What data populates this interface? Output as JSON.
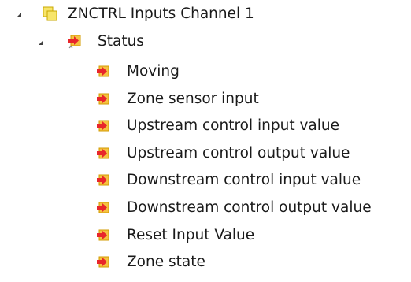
{
  "tree": {
    "root": {
      "label": "ZNCTRL Inputs Channel 1",
      "icon": "folder-group-icon",
      "expanded": true,
      "children": [
        {
          "label": "Status",
          "icon": "input-variable-icon",
          "expanded": true,
          "children": [
            {
              "label": "Moving",
              "icon": "input-variable-icon"
            },
            {
              "label": "Zone sensor input",
              "icon": "input-variable-icon"
            },
            {
              "label": "Upstream control input value",
              "icon": "input-variable-icon"
            },
            {
              "label": "Upstream control output value",
              "icon": "input-variable-icon"
            },
            {
              "label": "Downstream control input value",
              "icon": "input-variable-icon"
            },
            {
              "label": "Downstream control output value",
              "icon": "input-variable-icon"
            },
            {
              "label": "Reset Input Value",
              "icon": "input-variable-icon"
            },
            {
              "label": "Zone state",
              "icon": "input-variable-icon"
            }
          ]
        }
      ]
    }
  },
  "colors": {
    "folder_fill": "#f7e56a",
    "folder_stroke": "#c9a800",
    "variable_arrow": "#e8262b",
    "variable_box": "#f5c242",
    "expander": "#404040",
    "text": "#1a1a1a"
  }
}
